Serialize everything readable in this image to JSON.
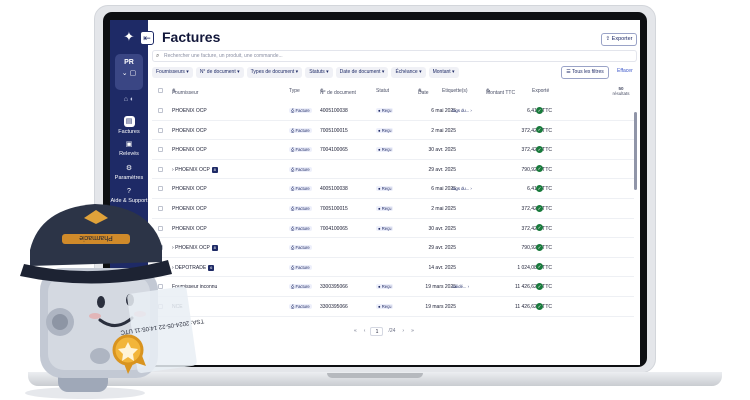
{
  "page": {
    "title": "Factures",
    "export_label": "Exporter"
  },
  "sidebar": {
    "user_initials": "PR",
    "items": [
      {
        "label": "Factures",
        "icon": "document-icon",
        "active": true
      },
      {
        "label": "Relevés",
        "icon": "statement-icon",
        "active": false
      },
      {
        "label": "Paramètres",
        "icon": "gear-icon",
        "active": false
      },
      {
        "label": "Aide & Support",
        "icon": "help-icon",
        "active": false
      }
    ]
  },
  "search": {
    "placeholder": "Rechercher une facture, un produit, une commande..."
  },
  "filters": [
    "Fournisseurs",
    "N° de document",
    "Types de document",
    "Statuts",
    "Date de document",
    "Échéance",
    "Montant"
  ],
  "filters_all": "Tous les filtres",
  "filters_clear": "Effacer",
  "columns": [
    "Fournisseur",
    "Type",
    "N° de document",
    "Statut",
    "Date",
    "Etiquette(s)",
    "Montant TTC",
    "Exporté"
  ],
  "results": {
    "count": "50",
    "label": "résultats"
  },
  "rows": [
    {
      "supplier": "PHOENIX OCP",
      "type": "Facture",
      "doc": "4005100038",
      "status": "Reçu",
      "date": "6 mai 2025",
      "tag": "tags du...",
      "amount": "6,41 € TTC"
    },
    {
      "supplier": "PHOENIX OCP",
      "type": "Facture",
      "doc": "7005100015",
      "status": "Reçu",
      "date": "2 mai 2025",
      "tag": "",
      "amount": "372,42 € TTC"
    },
    {
      "supplier": "PHOENIX OCP",
      "type": "Facture",
      "doc": "7004100065",
      "status": "Reçu",
      "date": "30 avr. 2025",
      "tag": "",
      "amount": "372,42 € TTC"
    },
    {
      "supplier": "PHOENIX OCP",
      "type": "Facture",
      "doc": "",
      "status": "",
      "date": "29 avr. 2025",
      "tag": "",
      "amount": "790,92 € TTC",
      "group": "8"
    },
    {
      "supplier": "PHOENIX OCP",
      "type": "Facture",
      "doc": "4005100038",
      "status": "Reçu",
      "date": "6 mai 2025",
      "tag": "tags du...",
      "amount": "6,41 € TTC"
    },
    {
      "supplier": "PHOENIX OCP",
      "type": "Facture",
      "doc": "7005100015",
      "status": "Reçu",
      "date": "2 mai 2025",
      "tag": "",
      "amount": "372,42 € TTC"
    },
    {
      "supplier": "PHOENIX OCP",
      "type": "Facture",
      "doc": "7004100065",
      "status": "Reçu",
      "date": "30 avr. 2025",
      "tag": "",
      "amount": "372,42 € TTC"
    },
    {
      "supplier": "PHOENIX OCP",
      "type": "Facture",
      "doc": "",
      "status": "",
      "date": "29 avr. 2025",
      "tag": "",
      "amount": "790,92 € TTC",
      "group": "8"
    },
    {
      "supplier": "DEPOTRADE",
      "type": "Facture",
      "doc": "",
      "status": "",
      "date": "14 avr. 2025",
      "tag": "",
      "amount": "1 024,08 € TTC",
      "group": "6"
    },
    {
      "supplier": "Fournisseur inconnu",
      "type": "Facture",
      "doc": "3300395066",
      "status": "Reçu",
      "date": "19 mars 2025",
      "tag": "validé...",
      "amount": "11 426,62 € TTC"
    },
    {
      "supplier": "NCE",
      "type": "Facture",
      "doc": "3300395066",
      "status": "Reçu",
      "date": "19 mars 2025",
      "tag": "",
      "amount": "11 426,62 € TTC"
    }
  ],
  "pager": {
    "page": "1",
    "total": "/24"
  },
  "mascot": {
    "cap_text": "Pharmacie",
    "stamp_text": "TSA: 2024-05-22 14:05:11 UTC"
  }
}
